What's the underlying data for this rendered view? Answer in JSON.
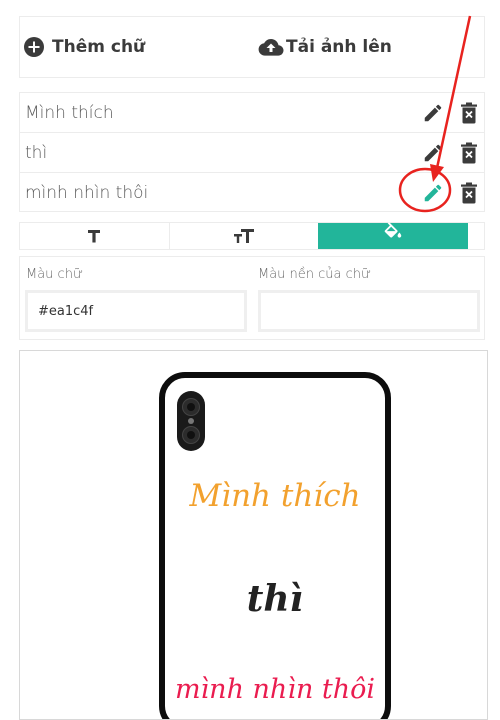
{
  "toolbar": {
    "add_text_label": "Thêm chữ",
    "upload_label": "Tải ảnh lên"
  },
  "text_items": [
    {
      "label": "Mình thích"
    },
    {
      "label": "thì"
    },
    {
      "label": "mình nhìn thôi"
    }
  ],
  "tabs": [
    {
      "icon": "text-icon"
    },
    {
      "icon": "text-size-icon"
    },
    {
      "icon": "fill-color-icon",
      "active": true
    }
  ],
  "color_panel": {
    "text_color_label": "Màu chữ",
    "text_color_value": "#ea1c4f",
    "bg_color_label": "Màu nền của chữ",
    "bg_color_value": ""
  },
  "preview": {
    "line_1": "Mình thích",
    "line_2": "thì",
    "line_3": "mình nhìn thôi",
    "line_1_color": "#f2a12e",
    "line_2_color": "#222222",
    "line_3_color": "#ea1c4f"
  },
  "colors": {
    "accent": "#22b59a",
    "annotation": "#e8231f",
    "icon": "#3b3b3b"
  }
}
